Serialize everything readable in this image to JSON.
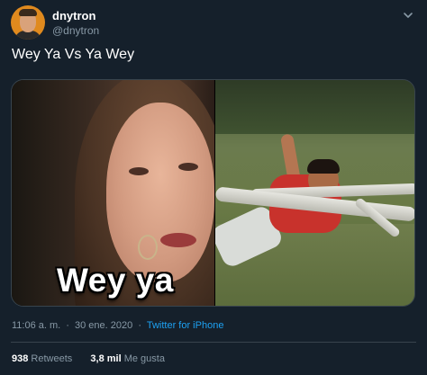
{
  "user": {
    "display_name": "dnytron",
    "handle": "@dnytron"
  },
  "tweet": {
    "text": "Wey Ya Vs Ya Wey",
    "media": {
      "left_caption": "Wey ya"
    },
    "time": "11:06 a. m.",
    "separator": "·",
    "date": "30 ene. 2020",
    "source": "Twitter for iPhone"
  },
  "stats": {
    "retweets_count": "938",
    "retweets_label": "Retweets",
    "likes_count": "3,8 mil",
    "likes_label": "Me gusta"
  },
  "icons": {
    "menu": "chevron-down-icon"
  },
  "colors": {
    "background": "#15202b",
    "muted_text": "#8899a6",
    "link": "#1da1f2",
    "border": "#38444d"
  }
}
